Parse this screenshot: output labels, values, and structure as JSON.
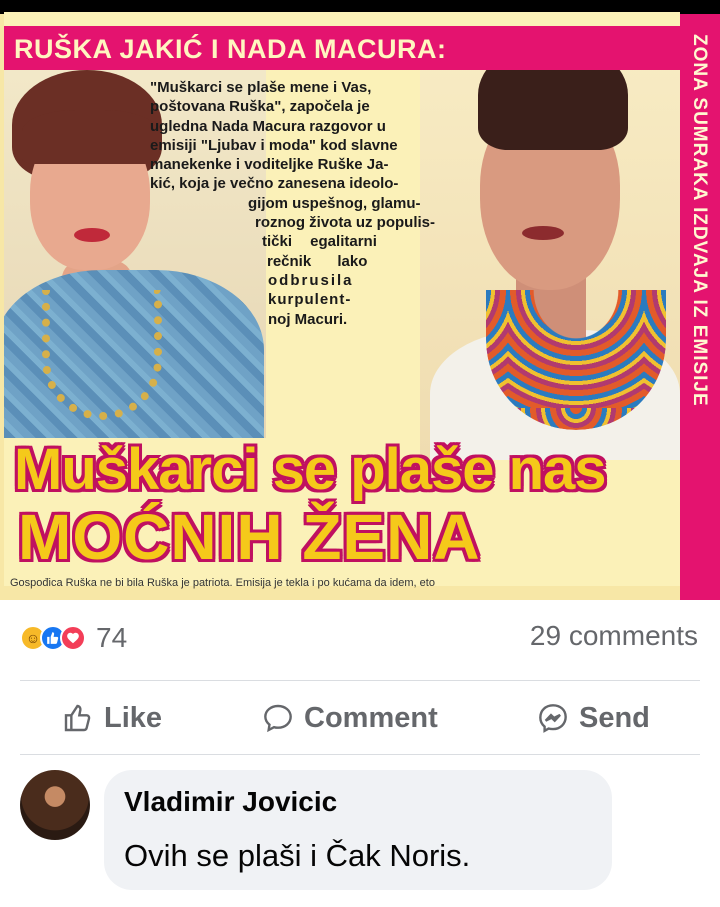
{
  "clipping": {
    "headline_top": "RUŠKA JAKIĆ I NADA MACURA:",
    "side_banner": "ZONA SUMRAKA IZDVAJA IZ EMISIJE",
    "quote_lines": [
      "\"Muškarci se plaše mene i Vas,",
      "poštovana Ruška\", započela je",
      "ugledna Nada Macura razgovor u",
      "emisiji \"Ljubav i moda\" kod slavne",
      "manekenke i voditeljke Ruške Ja-",
      "kić, koja je večno zanesena ideolo-",
      "gijom uspešnog, glamu-",
      "roznog života uz populis-",
      "tički egalitarni",
      "rečnik lako",
      "odbrusila",
      "kurpulent-",
      "noj Macuri."
    ],
    "big_headline_line1": "Muškarci se plaše nas",
    "big_headline_line2": "MOĆNIH ŽENA",
    "caption": "Gospođica Ruška ne bi bila Ruška je patriota. Emisija je tekla i po kućama da idem, eto"
  },
  "post": {
    "reaction_count": "74",
    "comments_label": "29 comments",
    "actions": {
      "like": "Like",
      "comment": "Comment",
      "send": "Send"
    }
  },
  "comment": {
    "author": "Vladimir Jovicic",
    "text": "Ovih se plaši i Čak Noris."
  },
  "colors": {
    "magenta": "#e4136f",
    "headline_yellow": "#f5c91a",
    "fb_gray": "#65676b",
    "fb_blue": "#1877f2"
  }
}
